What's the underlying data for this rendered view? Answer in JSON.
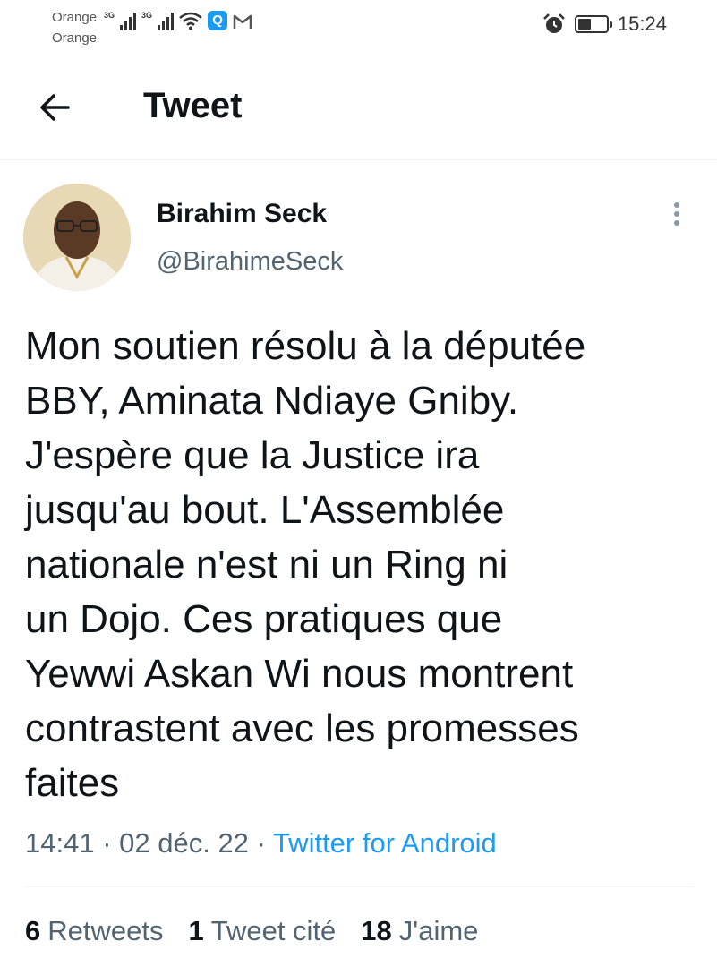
{
  "status_bar": {
    "carrier_1": "Orange",
    "carrier_2": "Orange",
    "network_1": "3G",
    "network_2": "3G",
    "app_badge_letter": "Q",
    "time": "15:24",
    "icons": [
      "signal-icon",
      "signal-icon",
      "wifi-icon",
      "app-notification-icon",
      "gmail-icon",
      "alarm-icon",
      "battery-icon"
    ]
  },
  "header": {
    "title": "Tweet",
    "back_icon": "arrow-left-icon"
  },
  "tweet": {
    "author_name": "Birahim Seck",
    "author_handle": "@BirahimeSeck",
    "text": "Mon soutien résolu à la députée\nBBY, Aminata Ndiaye Gniby.\nJ'espère que la Justice ira\njusqu'au bout. L'Assemblée\nnationale n'est ni un Ring ni\nun Dojo. Ces pratiques que\nYewwi Askan Wi nous montrent\ncontrastent avec les  promesses\nfaites",
    "time": "14:41",
    "date": "02 déc. 22",
    "source": "Twitter for Android"
  },
  "stats": {
    "retweets_count": "6",
    "retweets_label": "Retweets",
    "quotes_count": "1",
    "quotes_label": "Tweet cité",
    "likes_count": "18",
    "likes_label": "J'aime"
  },
  "colors": {
    "accent": "#1d9bf0",
    "text_primary": "#0f1419",
    "text_secondary": "#536471"
  }
}
